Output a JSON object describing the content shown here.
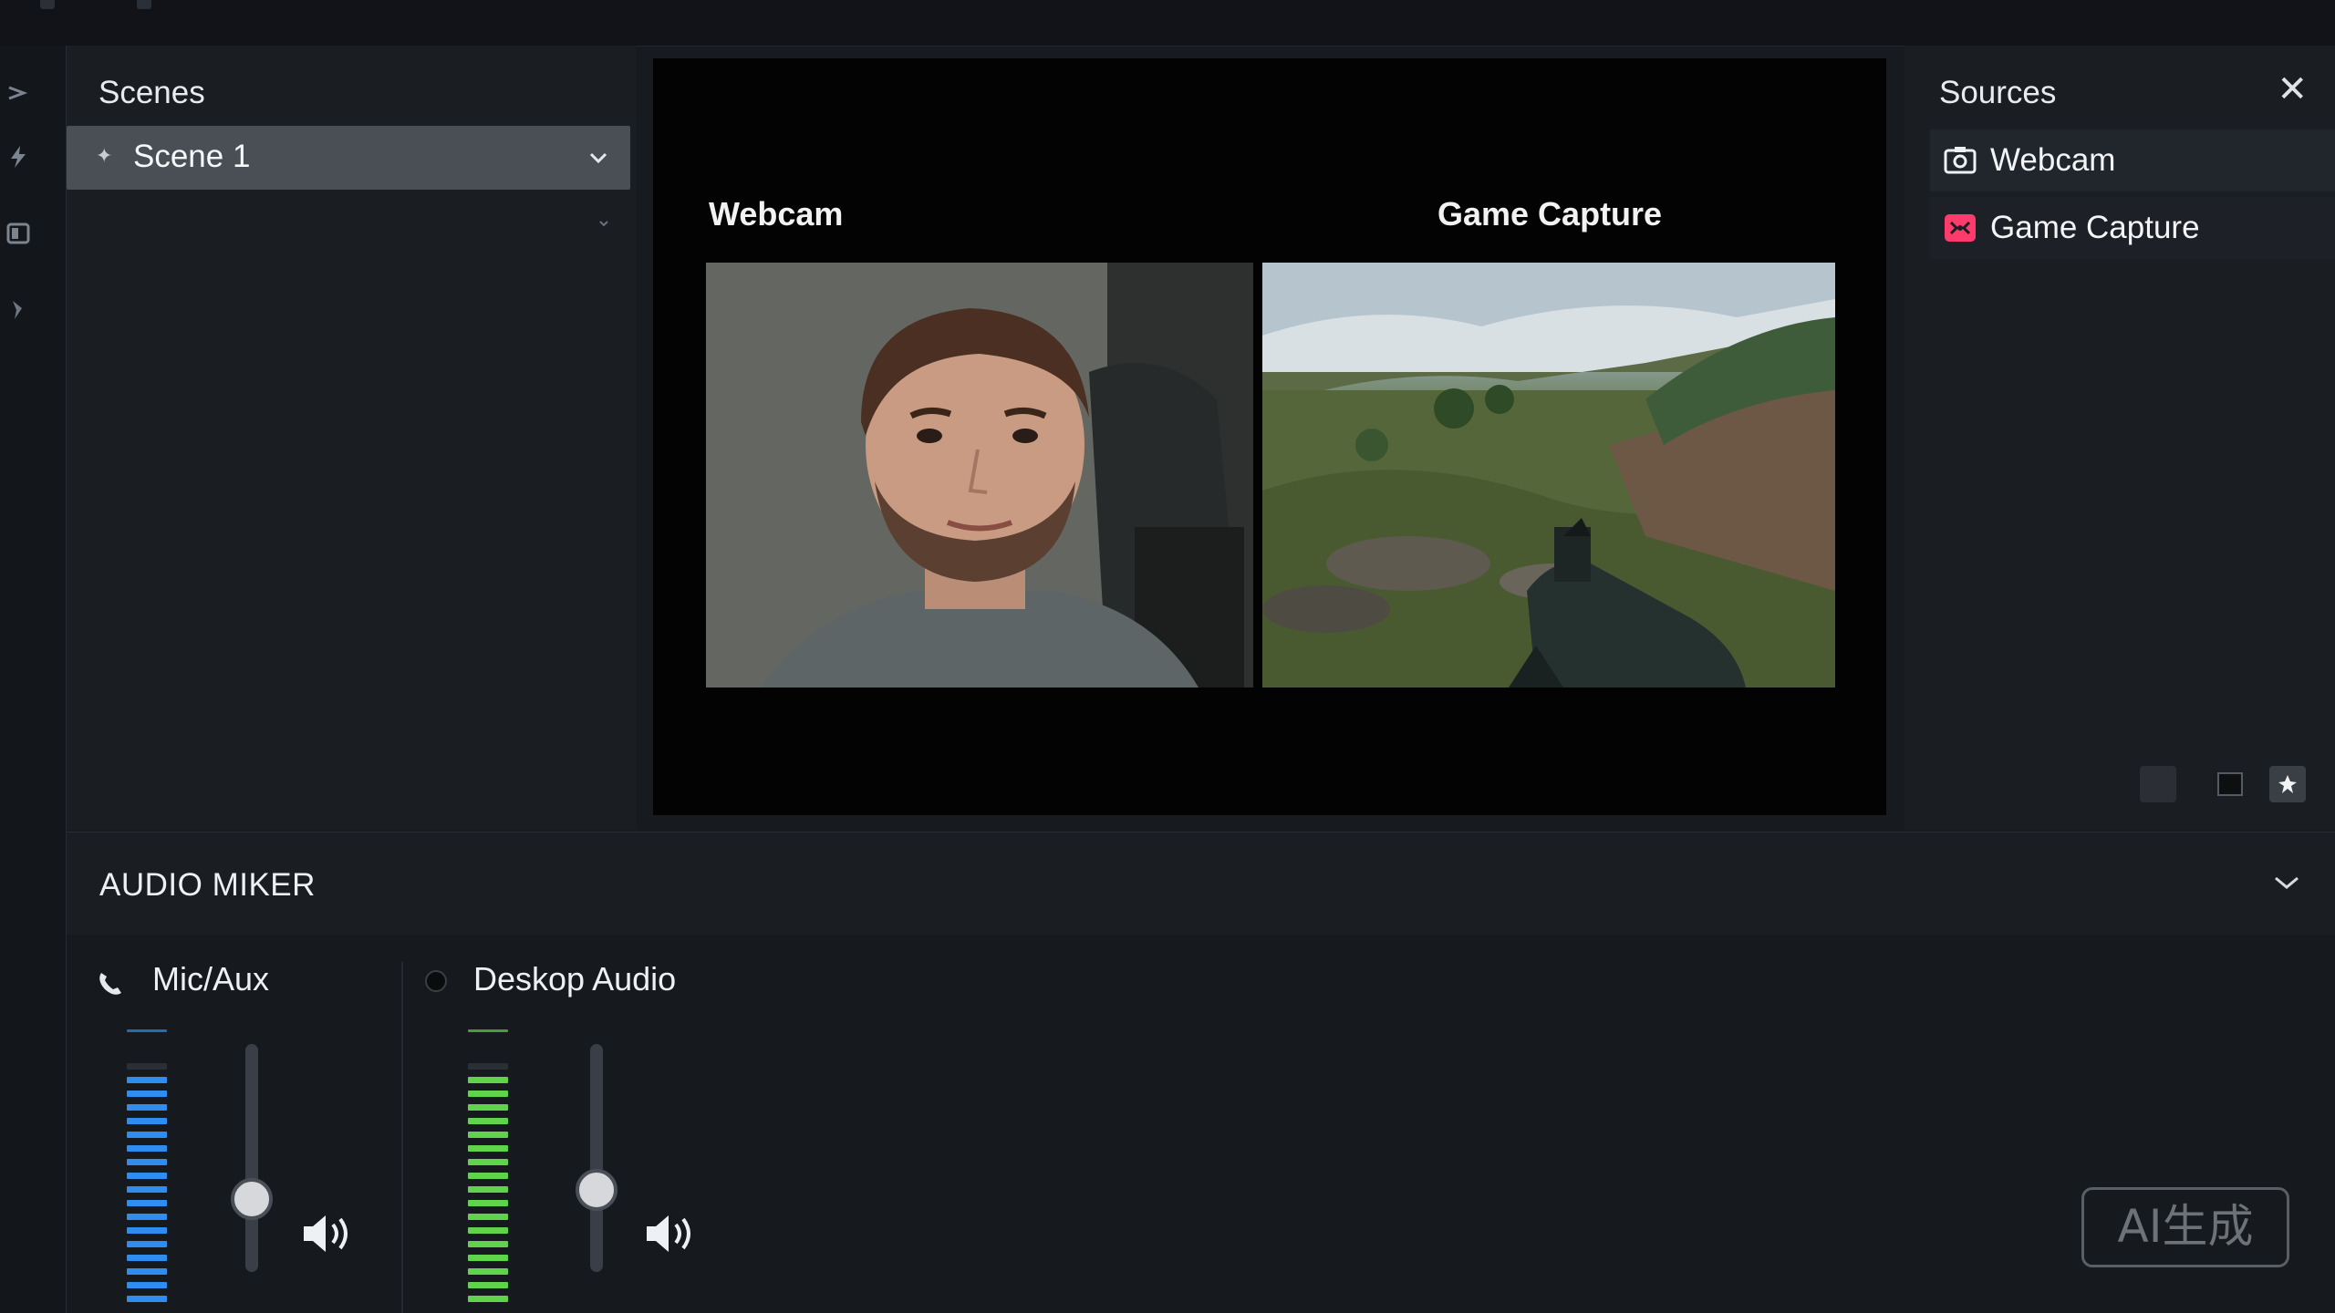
{
  "scenes": {
    "title": "Scenes",
    "items": [
      {
        "label": "Scene 1"
      }
    ]
  },
  "preview": {
    "sources": [
      {
        "label": "Webcam"
      },
      {
        "label": "Game Capture"
      }
    ]
  },
  "sources": {
    "title": "Sources",
    "items": [
      {
        "label": "Webcam",
        "icon": "camera-icon"
      },
      {
        "label": "Game Capture",
        "icon": "gamepad-icon"
      }
    ]
  },
  "mixer": {
    "title": "AUDIO MIKER",
    "channels": [
      {
        "name": "Mic/Aux",
        "icon": "phone-icon",
        "level": 0.95,
        "meter_color": "#2f8df0",
        "volume": 0.32
      },
      {
        "name": "Deskop Audio",
        "icon": "record-dot-icon",
        "level": 0.95,
        "meter_color": "#5fd34a",
        "volume": 0.36
      }
    ]
  },
  "watermark": "AI生成",
  "colors": {
    "background": "#171a1f",
    "panel": "#1a1d22",
    "selected_scene": "#4a4f56",
    "preview": "#030303",
    "game_capture_icon": "#ff3b6b"
  }
}
